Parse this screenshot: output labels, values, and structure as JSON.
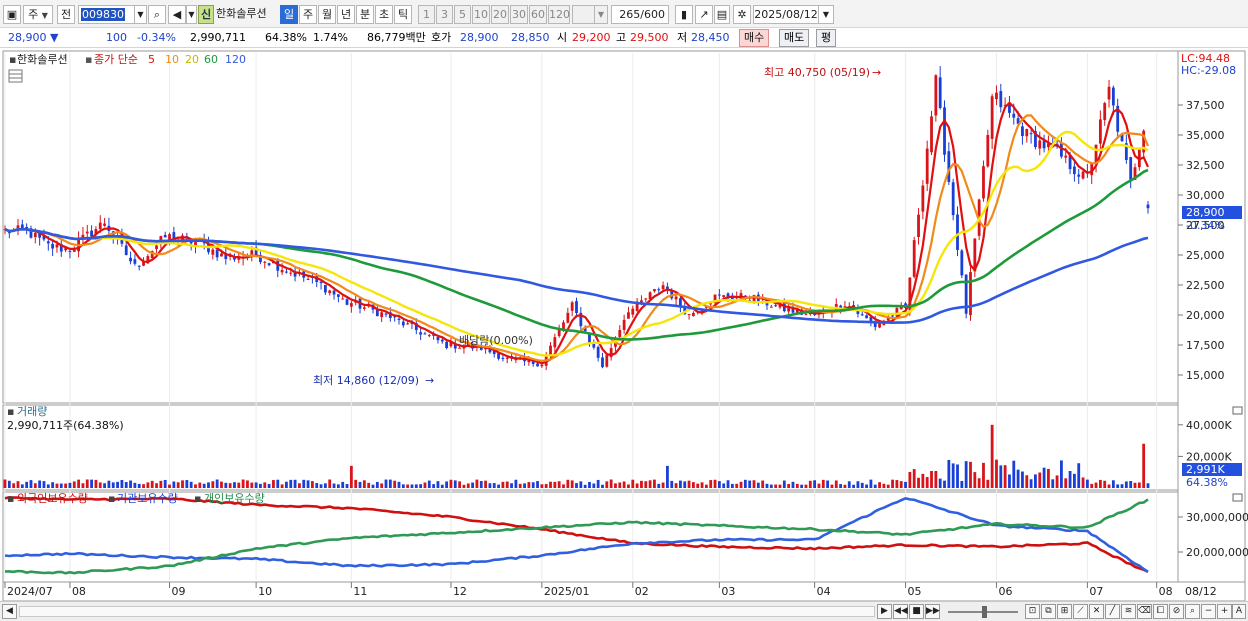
{
  "toolbar": {
    "period_main": "주",
    "prev_label": "전",
    "code": "009830",
    "new_badge": "신",
    "stock_name": "한화솔루션",
    "periods": [
      "일",
      "주",
      "월",
      "년",
      "분",
      "초",
      "틱"
    ],
    "active_period": "일",
    "minutes": [
      "1",
      "3",
      "5",
      "10",
      "20",
      "30",
      "60",
      "120"
    ],
    "count": "265",
    "count_max": "/600",
    "date": "2025/08/12"
  },
  "quote": {
    "price": "28,900",
    "arrow": "▼",
    "change": "100",
    "change_pct": "-0.34%",
    "volume": "2,990,711",
    "vol_ratio": "64.38%",
    "turnover_rate": "1.74%",
    "trade_value": "86,779백만",
    "bid_label": "호가",
    "ask": "28,900",
    "bid": "28,850",
    "open_label": "시",
    "open": "29,200",
    "high_label": "고",
    "high": "29,500",
    "low_label": "저",
    "low": "28,450",
    "buy_btn": "매수",
    "sell_btn": "매도",
    "eval_btn": "평"
  },
  "price_panel": {
    "legend_name": "한화솔루션",
    "legend_ma_title": "종가 단순",
    "legend_ma": [
      "5",
      "10",
      "20",
      "60",
      "120"
    ],
    "lc": "LC:94.48",
    "hc": "HC:-29.08",
    "high_note": "최고 40,750 (05/19)",
    "low_note": "최저 14,860 (12/09)",
    "dividend_note": "배당락(0.00%)",
    "current_tag": "28,900",
    "current_pct": "-0.34%"
  },
  "volume_panel": {
    "title": "거래량",
    "value": "2,990,711주(64.38%)",
    "current_tag": "2,991K",
    "current_pct": "64.38%"
  },
  "holdings_panel": {
    "series": [
      "외국인보유수량",
      "기관보유수량",
      "개인보유수량"
    ]
  },
  "colors": {
    "up": "#d8141b",
    "down": "#1a3fd8",
    "ma5": "#e01010",
    "ma10": "#f08a1a",
    "ma20": "#f5e60a",
    "ma60": "#1e9a3a",
    "ma120": "#3158e0",
    "foreign": "#d01010",
    "institution": "#3060e0",
    "individual": "#2e9a55"
  },
  "chart_data": [
    {
      "type": "candlestick",
      "title": "한화솔루션",
      "y_ticks": [
        "37,500",
        "35,000",
        "32,500",
        "30,000",
        "27,500",
        "25,000",
        "22,500",
        "20,000",
        "17,500",
        "15,000"
      ],
      "ylim": [
        13000,
        41500
      ],
      "x_ticks": [
        "2024/07",
        "08",
        "09",
        "10",
        "11",
        "12",
        "2025/01",
        "02",
        "03",
        "04",
        "05",
        "06",
        "07",
        "08",
        "08/12"
      ],
      "ohlc_monthly": [
        {
          "month": "2024/07",
          "open": 27000,
          "high": 28500,
          "low": 24500,
          "close": 25500
        },
        {
          "month": "08",
          "open": 25500,
          "high": 29000,
          "low": 22500,
          "close": 26500
        },
        {
          "month": "09",
          "open": 26500,
          "high": 27000,
          "low": 23000,
          "close": 25000
        },
        {
          "month": "10",
          "open": 25000,
          "high": 26500,
          "low": 20000,
          "close": 21000
        },
        {
          "month": "11",
          "open": 21000,
          "high": 22500,
          "low": 16500,
          "close": 17500
        },
        {
          "month": "12",
          "open": 17500,
          "high": 18500,
          "low": 14860,
          "close": 16000
        },
        {
          "month": "2025/01",
          "open": 16000,
          "high": 21000,
          "low": 15500,
          "close": 20500
        },
        {
          "month": "02",
          "open": 20500,
          "high": 23500,
          "low": 19500,
          "close": 21500
        },
        {
          "month": "03",
          "open": 21500,
          "high": 23000,
          "low": 19500,
          "close": 20000
        },
        {
          "month": "04",
          "open": 20000,
          "high": 21500,
          "low": 18200,
          "close": 20500
        },
        {
          "month": "05",
          "open": 20500,
          "high": 40750,
          "low": 20000,
          "close": 38000
        },
        {
          "month": "06",
          "open": 38000,
          "high": 38500,
          "low": 29000,
          "close": 31500
        },
        {
          "month": "07",
          "open": 31500,
          "high": 40000,
          "low": 30500,
          "close": 37500
        },
        {
          "month": "08",
          "open": 37500,
          "high": 38500,
          "low": 28450,
          "close": 28900
        }
      ]
    },
    {
      "type": "bar",
      "title": "거래량",
      "y_ticks": [
        "40,000K",
        "20,000K"
      ],
      "ylim": [
        0,
        50000
      ],
      "unit": "K shares",
      "notable_values": [
        {
          "date": "06",
          "value": 40000
        },
        {
          "date": "08",
          "value": 28000
        },
        {
          "date": "08/12",
          "value": 2991
        }
      ]
    },
    {
      "type": "line",
      "title": "보유수량",
      "y_ticks": [
        "30,000,000",
        "20,000,000"
      ],
      "ylim": [
        12000000,
        36000000
      ],
      "series": [
        {
          "name": "외국인보유수량",
          "values": [
            35500000,
            35000000,
            35200000,
            33500000,
            32500000,
            30000000,
            26500000,
            22500000,
            21500000,
            21000000,
            22000000,
            21500000,
            22500000,
            13500000
          ]
        },
        {
          "name": "기관보유수량",
          "values": [
            19000000,
            19500000,
            18500000,
            18000000,
            16000000,
            16500000,
            19000000,
            22500000,
            23500000,
            23500000,
            35500000,
            27500000,
            26000000,
            13500000
          ]
        },
        {
          "name": "개인보유수량",
          "values": [
            14500000,
            14000000,
            16000000,
            21000000,
            24000000,
            25500000,
            27000000,
            28500000,
            27500000,
            26500000,
            25000000,
            28000000,
            27000000,
            35500000
          ]
        }
      ]
    }
  ]
}
